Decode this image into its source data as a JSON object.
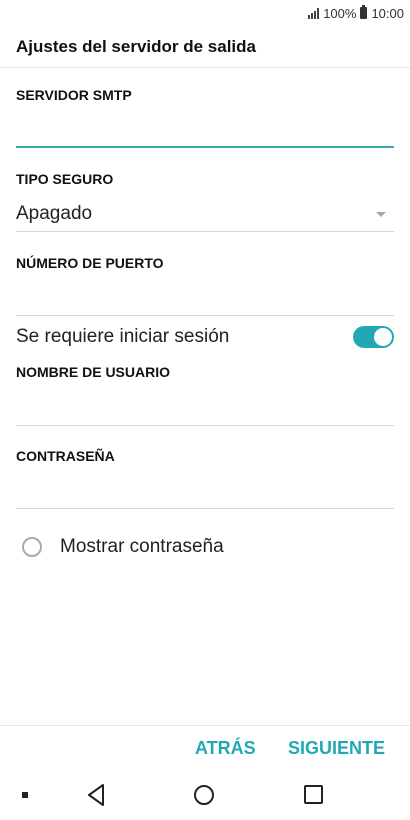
{
  "status_bar": {
    "battery": "100%",
    "time": "10:00"
  },
  "header": {
    "title": "Ajustes del servidor de salida"
  },
  "form": {
    "smtp_label": "SERVIDOR SMTP",
    "smtp_value": "",
    "security_label": "TIPO SEGURO",
    "security_value": "Apagado",
    "port_label": "NÚMERO DE PUERTO",
    "port_value": "",
    "login_required_label": "Se requiere iniciar sesión",
    "login_required": true,
    "username_label": "NOMBRE DE USUARIO",
    "username_value": "",
    "password_label": "CONTRASEÑA",
    "password_value": "",
    "show_password_label": "Mostrar contraseña",
    "show_password": false
  },
  "actions": {
    "back_label": "ATRÁS",
    "next_label": "SIGUIENTE"
  },
  "colors": {
    "accent": "#20a9b5",
    "focus_line": "#3aa9b3"
  },
  "icons": {
    "signal": "signal-icon",
    "battery": "battery-icon",
    "nav_back": "back-triangle-icon",
    "nav_home": "home-circle-icon",
    "nav_recent": "recents-square-icon"
  }
}
